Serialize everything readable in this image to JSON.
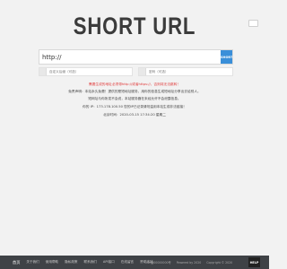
{
  "header": {
    "logo_text": "SHORT URL"
  },
  "shortener": {
    "url_value": "http://",
    "submit_label": "SHORT"
  },
  "options": {
    "custom_placeholder": "自定义后缀（可选）",
    "password_placeholder": "密码（可选）"
  },
  "notices": {
    "warning": "需要生成的地址必须带http://或者https://，否则将无法跳转！",
    "line1": "免责声明：本站永久免费！提供的是短地址服务，用你的信息生成短地址分享出去给别人。",
    "line2": "短网址与你所发不会说，本站服务器在未经允许不会泄露信息。",
    "ip_line": "你的 IP：173.178.100.50  您的IP已记录请勿滥用本站生成非法链接！",
    "time_line": "北京时间：2020-03-15 17:34:20 星期二"
  },
  "footer": {
    "nav": [
      "首页",
      "关于我们",
      "使用帮助",
      "隐私政策",
      "联系我们",
      "API接口",
      "在线留言",
      "赞助本站"
    ],
    "right_items": [
      "ICP备00000000号",
      "Powered by 2020",
      "Copyright © 2020"
    ],
    "help_label": "HELP"
  },
  "colors": {
    "accent": "#3a8fd9",
    "warning": "#e03a3a",
    "footer_bg": "#3f4246",
    "page_bg": "#f2f2f2"
  }
}
